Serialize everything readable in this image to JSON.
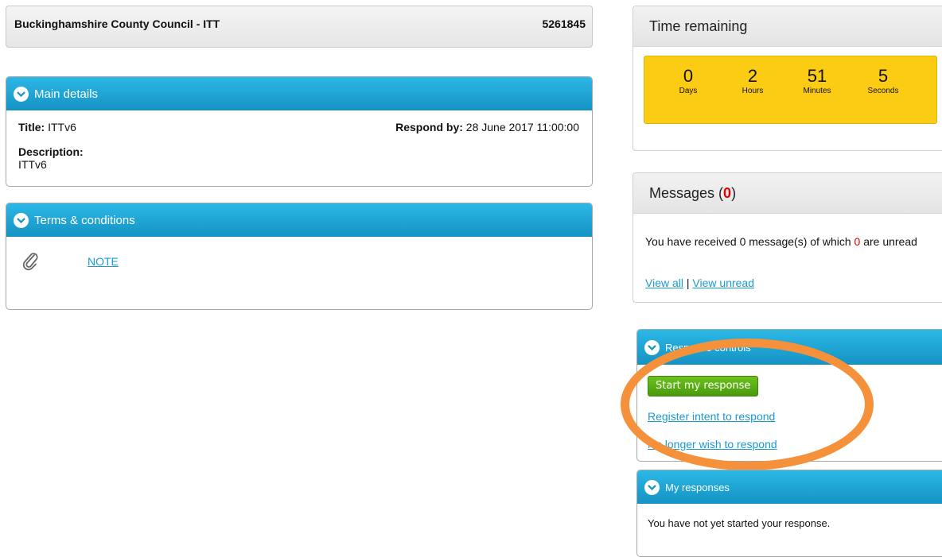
{
  "header": {
    "organisation": "Buckinghamshire County Council - ITT",
    "reference": "5261845"
  },
  "main_details": {
    "heading": "Main details",
    "title_label": "Title:",
    "title_value": "ITTv6",
    "respond_label": "Respond by:",
    "respond_value": "28 June 2017 11:00:00",
    "description_label": "Description:",
    "description_value": "ITTv6"
  },
  "terms": {
    "heading": "Terms & conditions",
    "link": "NOTE"
  },
  "time_remaining": {
    "heading": "Time remaining",
    "units": [
      {
        "value": "0",
        "label": "Days"
      },
      {
        "value": "2",
        "label": "Hours"
      },
      {
        "value": "51",
        "label": "Minutes"
      },
      {
        "value": "5",
        "label": "Seconds"
      }
    ]
  },
  "messages": {
    "heading": "Messages (",
    "count": "0",
    "heading_end": ")",
    "body_pre": "You have received 0 message(s) of which ",
    "unread_count": "0",
    "body_post": " are unread",
    "view_all": "View all",
    "separator": " | ",
    "view_unread": "View unread"
  },
  "response_controls": {
    "heading": "Response controls",
    "start_button": "Start my response",
    "register_link": "Register intent to respond",
    "no_longer_link": "No longer wish to respond"
  },
  "my_responses": {
    "heading": "My responses",
    "text": "You have not yet started your response."
  },
  "colors": {
    "accent_blue": "#1a9ad2",
    "countdown_yellow": "#fccb14",
    "start_green": "#5aaa14",
    "highlight_orange": "#f6913b",
    "alert_red": "#e00000"
  }
}
